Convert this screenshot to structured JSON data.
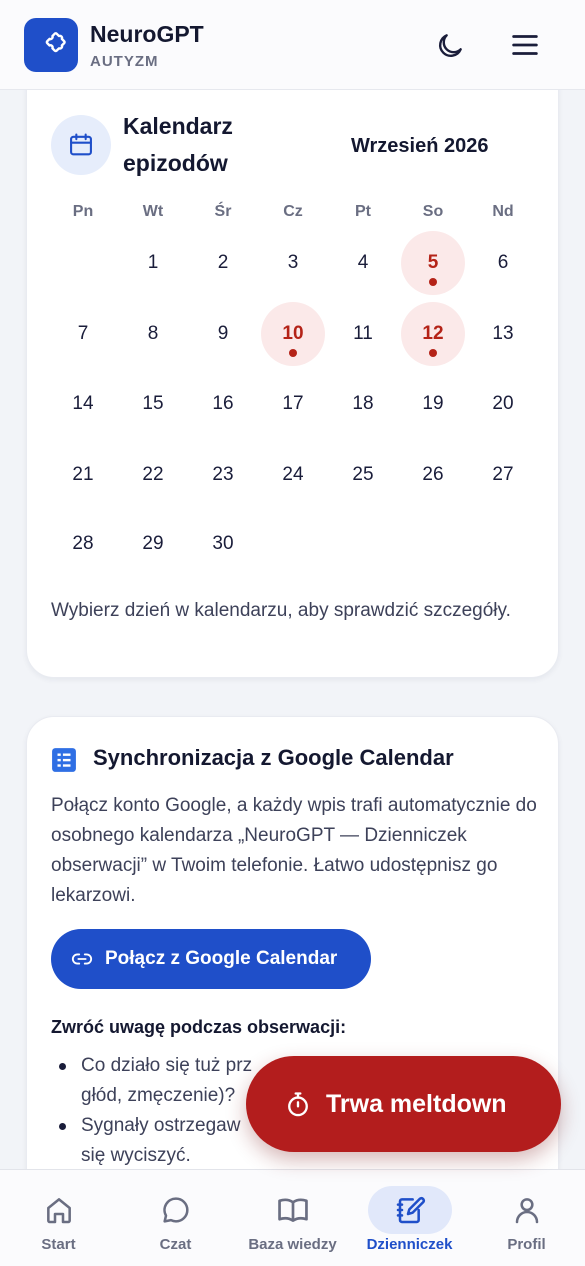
{
  "header": {
    "app_title": "NeuroGPT",
    "app_subtitle": "AUTYZM",
    "brand_color": "#1f4fc9",
    "icons": [
      "puzzle-icon",
      "moon-icon",
      "hamburger-menu-icon"
    ]
  },
  "calendar": {
    "title": "Kalendarz epizodów",
    "month_label": "Wrzesień 2026",
    "weekdays": [
      "Pn",
      "Wt",
      "Śr",
      "Cz",
      "Pt",
      "So",
      "Nd"
    ],
    "weeks": [
      [
        "",
        "1",
        "2",
        "3",
        "4",
        "5",
        "6"
      ],
      [
        "7",
        "8",
        "9",
        "10",
        "11",
        "12",
        "13"
      ],
      [
        "14",
        "15",
        "16",
        "17",
        "18",
        "19",
        "20"
      ],
      [
        "21",
        "22",
        "23",
        "24",
        "25",
        "26",
        "27"
      ],
      [
        "28",
        "29",
        "30",
        "",
        "",
        "",
        ""
      ]
    ],
    "episode_days": [
      "5",
      "10",
      "12"
    ],
    "episode_color": "#b42318",
    "hint": "Wybierz dzień w kalendarzu, aby sprawdzić szczegóły."
  },
  "sync": {
    "title": "Synchronizacja z Google Calendar",
    "description": "Połącz konto Google, a każdy wpis trafi automatycznie do osobnego kalendarza „NeuroGPT — Dzienniczek obserwacji” w Twoim telefonie. Łatwo udostępnisz go lekarzowi.",
    "button_label": "Połącz z Google Calendar",
    "attention_title": "Zwróć uwagę podczas obserwacji:",
    "attention_items": [
      "Co działo się tuż prz",
      "głód, zmęczenie)?",
      "Sygnały ostrzegaw",
      "się wyciszyć."
    ]
  },
  "fab": {
    "label": "Trwa meltdown",
    "color": "#b31d1d"
  },
  "bottom_nav": {
    "items": [
      {
        "label": "Start",
        "icon": "home-icon"
      },
      {
        "label": "Czat",
        "icon": "chat-bubble-icon"
      },
      {
        "label": "Baza wiedzy",
        "icon": "book-icon"
      },
      {
        "label": "Dzienniczek",
        "icon": "notebook-pen-icon",
        "active": true
      },
      {
        "label": "Profil",
        "icon": "person-icon"
      }
    ]
  }
}
